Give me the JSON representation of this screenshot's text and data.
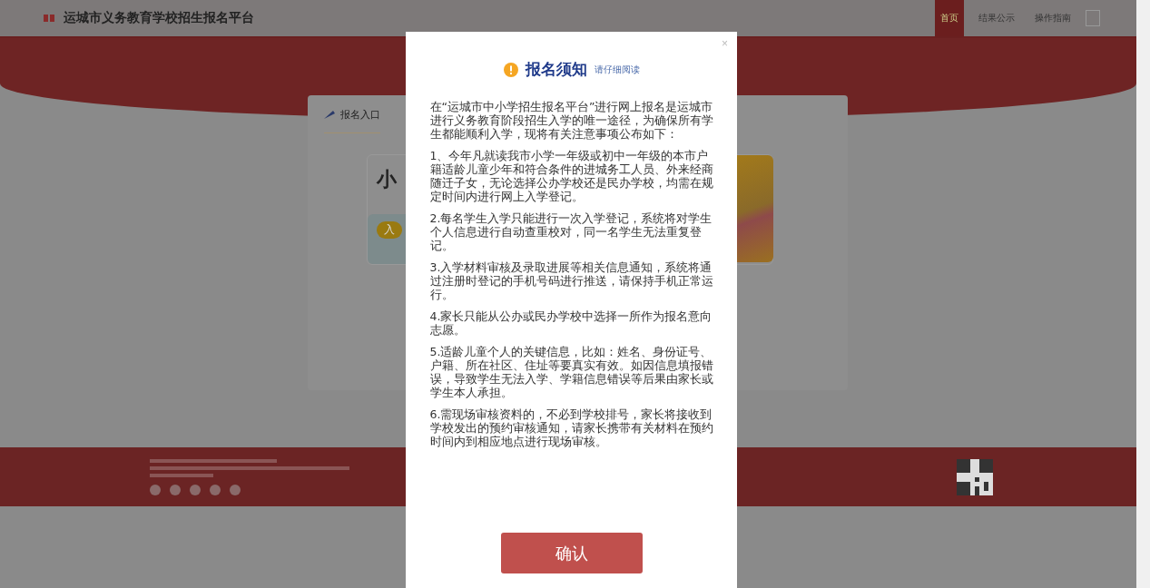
{
  "header": {
    "title": "运城市义务教育学校招生报名平台",
    "nav": [
      {
        "label": "首页",
        "selected": true
      },
      {
        "label": "结果公示",
        "selected": false
      },
      {
        "label": "操作指南",
        "selected": false
      }
    ]
  },
  "card": {
    "tab": "报名入口",
    "heading": "小",
    "badge": "入"
  },
  "modal": {
    "title": "报名须知",
    "subtitle": "请仔细阅读",
    "close": "×",
    "paragraphs": [
      "在“运城市中小学招生报名平台”进行网上报名是运城市进行义务教育阶段招生入学的唯一途径，为确保所有学生都能顺利入学，现将有关注意事项公布如下：",
      "1、今年凡就读我市小学一年级或初中一年级的本市户籍适龄儿童少年和符合条件的进城务工人员、外来经商随迁子女，无论选择公办学校还是民办学校，均需在规定时间内进行网上入学登记。",
      "2.每名学生入学只能进行一次入学登记，系统将对学生个人信息进行自动查重校对，同一名学生无法重复登记。",
      "3.入学材料审核及录取进展等相关信息通知，系统将通过注册时登记的手机号码进行推送，请保持手机正常运行。",
      "4.家长只能从公办或民办学校中选择一所作为报名意向志愿。",
      "5.适龄儿童个人的关键信息，比如：姓名、身份证号、户籍、所在社区、住址等要真实有效。如因信息填报错误，导致学生无法入学、学籍信息错误等后果由家长或学生本人承担。",
      "6.需现场审核资料的，不必到学校排号，家长将接收到学校发出的预约审核通知，请家长携带有关材料在预约时间内到相应地点进行现场审核。"
    ],
    "confirm": "确认"
  }
}
